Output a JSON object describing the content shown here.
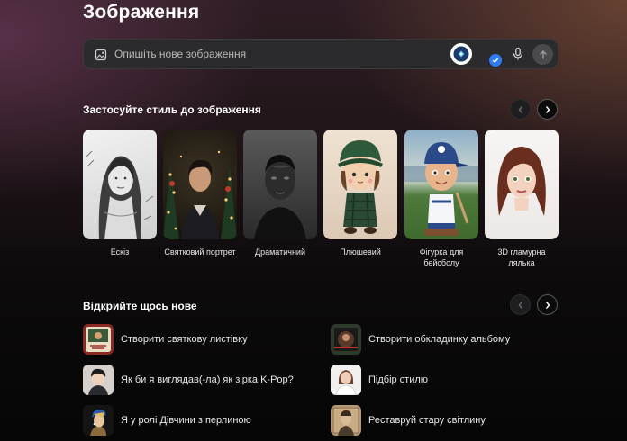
{
  "page_title": "Зображення",
  "prompt": {
    "placeholder": "Опишіть нове зображення",
    "value": "",
    "icons": [
      "image-icon",
      "designer-logo-icon",
      "check-icon",
      "microphone-icon",
      "arrow-up-icon"
    ]
  },
  "styles_section": {
    "title": "Застосуйте стиль до зображення",
    "items": [
      {
        "label": "Ескіз",
        "icon": "sketch-portrait"
      },
      {
        "label": "Святковий портрет",
        "icon": "holiday-portrait"
      },
      {
        "label": "Драматичний",
        "icon": "dramatic-portrait"
      },
      {
        "label": "Плюшевий",
        "icon": "plush-doll"
      },
      {
        "label": "Фігурка для бейсболу",
        "icon": "baseball-bobblehead"
      },
      {
        "label": "3D гламурна лялька",
        "icon": "glam-doll-3d"
      }
    ]
  },
  "discover_section": {
    "title": "Відкрийте щось нове",
    "items": [
      {
        "label": "Створити святкову листівку",
        "icon": "holiday-card-thumb"
      },
      {
        "label": "Створити обкладинку альбому",
        "icon": "album-cover-thumb"
      },
      {
        "label": "Як би я виглядав(-ла) як зірка K-Pop?",
        "icon": "kpop-thumb"
      },
      {
        "label": "Підбір стилю",
        "icon": "style-match-thumb"
      },
      {
        "label": "Я у ролі Дівчини з перлиною",
        "icon": "pearl-earring-thumb"
      },
      {
        "label": "Реставруй стару світлину",
        "icon": "restore-photo-thumb"
      }
    ]
  },
  "colors": {
    "accent_blue": "#2f7bf5",
    "prompt_bg": "#2b2b2d"
  }
}
